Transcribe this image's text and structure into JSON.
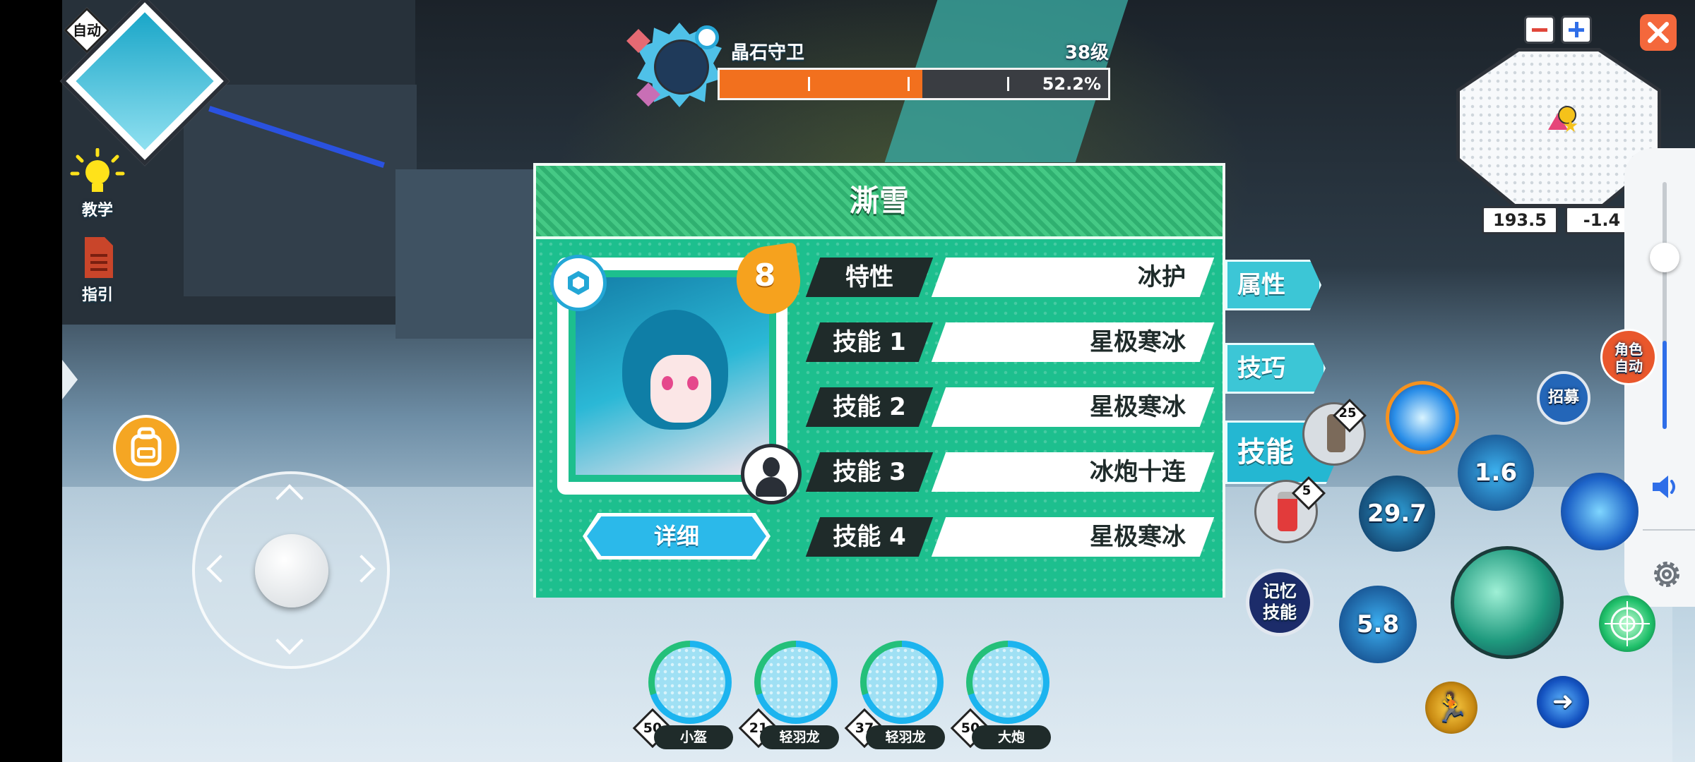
{
  "hud": {
    "auto_badge": "自动",
    "tutorial_label": "教学",
    "guide_label": "指引"
  },
  "boss": {
    "name": "晶石守卫",
    "level": "38级",
    "hp_percent_label": "52.2%",
    "hp_fraction": 0.522
  },
  "minimap": {
    "coord_x": "193.5",
    "coord_y": "-1.4"
  },
  "panel": {
    "title": "澌雪",
    "badge_level": "8",
    "detail_button": "详细",
    "rows": [
      {
        "label": "特性",
        "value": "冰护"
      },
      {
        "label": "技能 1",
        "value": "星极寒冰"
      },
      {
        "label": "技能 2",
        "value": "星极寒冰"
      },
      {
        "label": "技能 3",
        "value": "冰炮十连"
      },
      {
        "label": "技能 4",
        "value": "星极寒冰"
      }
    ]
  },
  "side_tabs": [
    "属性",
    "技巧",
    "技能"
  ],
  "skills": {
    "cooldown_1": "1.6",
    "cooldown_2": "29.7",
    "cooldown_3": "5.8",
    "item_count_1": "25",
    "item_count_2": "5",
    "memory_skill": "记忆\n技能",
    "recruit": "招募",
    "char_auto": "角色\n自动"
  },
  "pets": [
    {
      "level": "50",
      "name": "小盔"
    },
    {
      "level": "21",
      "name": "轻羽龙"
    },
    {
      "level": "37",
      "name": "轻羽龙"
    },
    {
      "level": "50",
      "name": "大炮"
    }
  ],
  "volume_level": 0.35,
  "colors": {
    "panel_green": "#1dbf8e",
    "hp_orange": "#f2701e",
    "tab_cyan": "#3cc6d6",
    "backpack_orange": "#f5a623",
    "close_orange": "#f4683c"
  }
}
